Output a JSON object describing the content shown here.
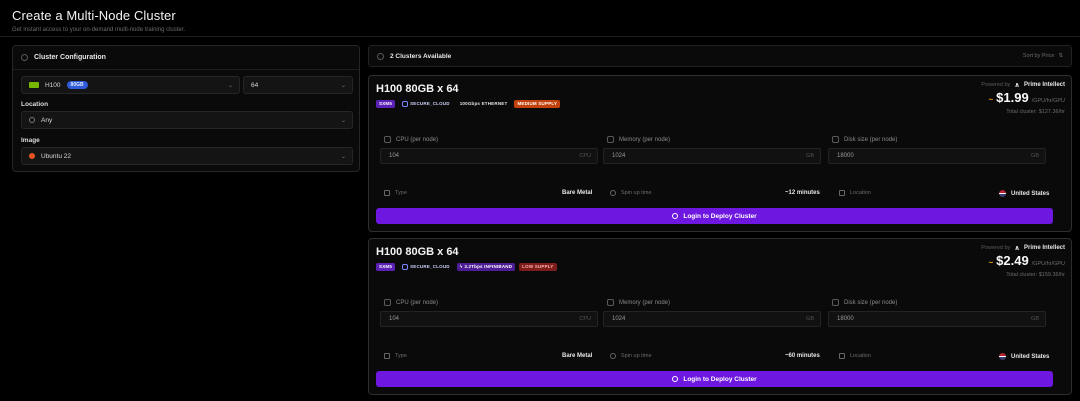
{
  "header": {
    "title": "Create a Multi-Node Cluster",
    "subtitle": "Get instant access to your on-demand multi-node training cluster."
  },
  "config": {
    "title": "Cluster Configuration",
    "gpu": {
      "name": "H100",
      "badge": "80GB"
    },
    "count": "64",
    "location_label": "Location",
    "location_value": "Any",
    "image_label": "Image",
    "image_value": "Ubuntu 22"
  },
  "topbar": {
    "count": "2 Clusters Available",
    "sort": "Sort by Price"
  },
  "clusters": [
    {
      "title": "H100 80GB x 64",
      "tags": [
        "SXM5",
        "SECURE_CLOUD",
        "100Gbps ETHERNET",
        "MEDIUM SUPPLY"
      ],
      "powered_by": "Powered by",
      "provider": "Prime Intellect",
      "price": "$1.99",
      "price_unit": "/GPU/hr/GPU",
      "total": "Total cluster: $127.36/hr",
      "cpu_label": "CPU (per node)",
      "cpu_value": "104",
      "cpu_unit": "CPU",
      "mem_label": "Memory (per node)",
      "mem_value": "1024",
      "mem_unit": "GB",
      "disk_label": "Disk size (per node)",
      "disk_value": "18000",
      "disk_unit": "GB",
      "type_label": "Type",
      "type_value": "Bare Metal",
      "spin_label": "Spin up time",
      "spin_value": "~12 minutes",
      "loc_label": "Location",
      "loc_value": "United States",
      "button": "Login to Deploy Cluster"
    },
    {
      "title": "H100 80GB x 64",
      "tags": [
        "SXM5",
        "SECURE_CLOUD",
        "3.2Tbps INFINIBAND",
        "LOW SUPPLY"
      ],
      "powered_by": "Powered by",
      "provider": "Prime Intellect",
      "price": "$2.49",
      "price_unit": "/GPU/hr/GPU",
      "total": "Total cluster: $159.36/hr",
      "cpu_label": "CPU (per node)",
      "cpu_value": "104",
      "cpu_unit": "CPU",
      "mem_label": "Memory (per node)",
      "mem_value": "1024",
      "mem_unit": "GB",
      "disk_label": "Disk size (per node)",
      "disk_value": "18000",
      "disk_unit": "GB",
      "type_label": "Type",
      "type_value": "Bare Metal",
      "spin_label": "Spin up time",
      "spin_value": "~60 minutes",
      "loc_label": "Location",
      "loc_value": "United States",
      "button": "Login to Deploy Cluster"
    }
  ],
  "colors": {
    "accent": "#6d17e0",
    "price_marker": "#f59e0b"
  }
}
